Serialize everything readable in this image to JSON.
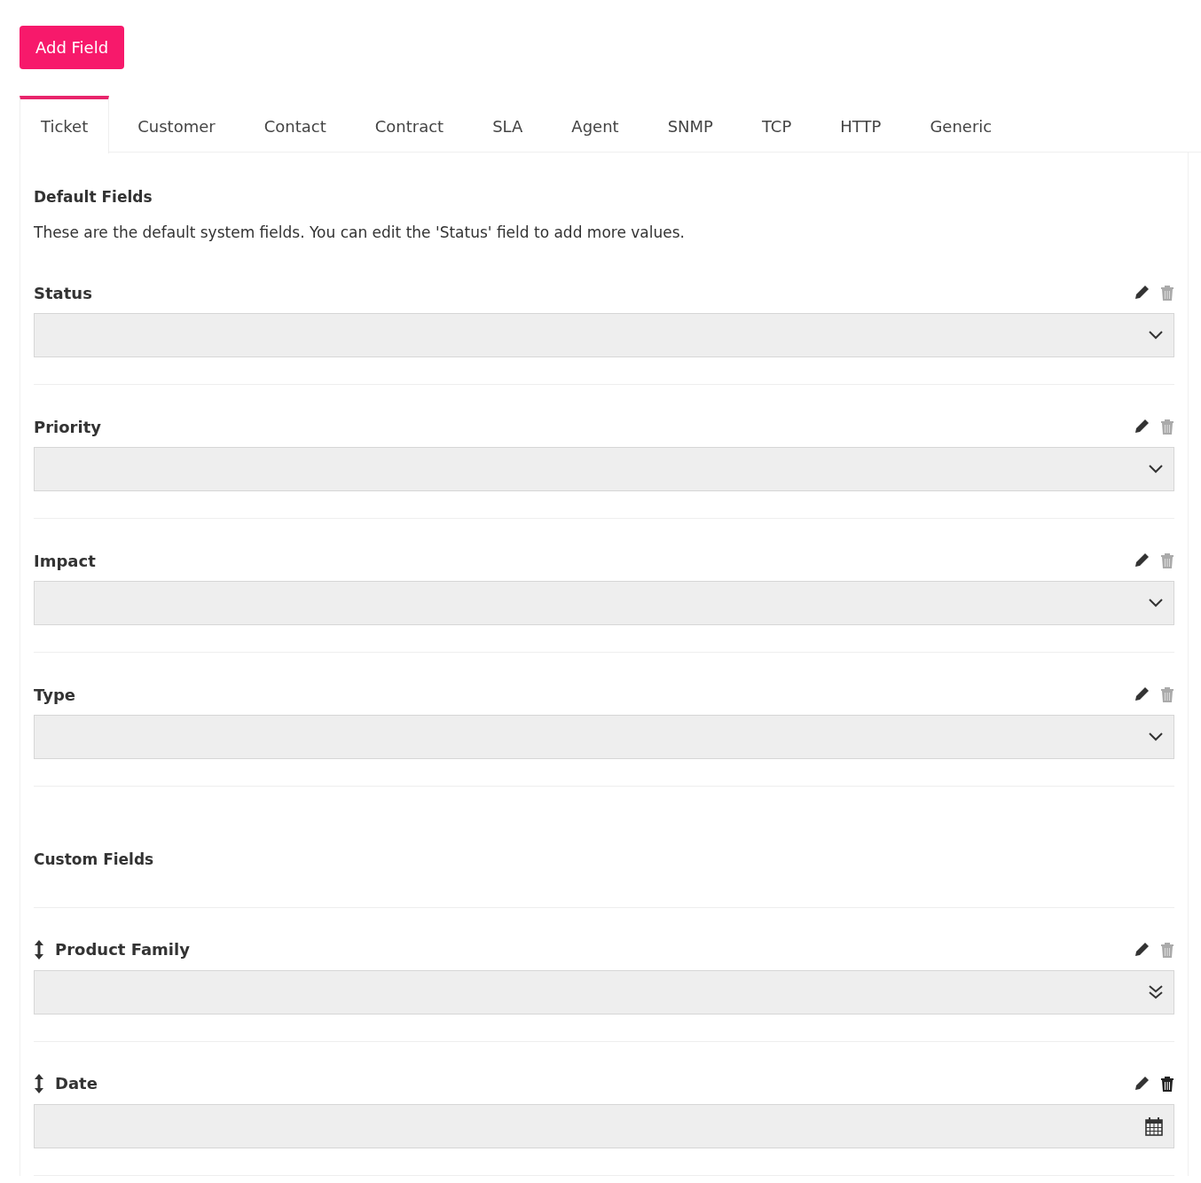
{
  "add_button": "Add Field",
  "tabs": [
    {
      "label": "Ticket",
      "selected": true
    },
    {
      "label": "Customer",
      "selected": false
    },
    {
      "label": "Contact",
      "selected": false
    },
    {
      "label": "Contract",
      "selected": false
    },
    {
      "label": "SLA",
      "selected": false
    },
    {
      "label": "Agent",
      "selected": false
    },
    {
      "label": "SNMP",
      "selected": false
    },
    {
      "label": "TCP",
      "selected": false
    },
    {
      "label": "HTTP",
      "selected": false
    },
    {
      "label": "Generic",
      "selected": false
    }
  ],
  "default_section": {
    "title": "Default Fields",
    "description": "These are the default system fields. You can edit the 'Status' field to add more values.",
    "fields": [
      {
        "label": "Status",
        "kind": "select",
        "draggable": false,
        "deletable": false
      },
      {
        "label": "Priority",
        "kind": "select",
        "draggable": false,
        "deletable": false
      },
      {
        "label": "Impact",
        "kind": "select",
        "draggable": false,
        "deletable": false
      },
      {
        "label": "Type",
        "kind": "select",
        "draggable": false,
        "deletable": false
      }
    ]
  },
  "custom_section": {
    "title": "Custom Fields",
    "fields": [
      {
        "label": "Product Family",
        "kind": "multiselect",
        "draggable": true,
        "deletable": false
      },
      {
        "label": "Date",
        "kind": "date",
        "draggable": true,
        "deletable": true
      }
    ]
  }
}
